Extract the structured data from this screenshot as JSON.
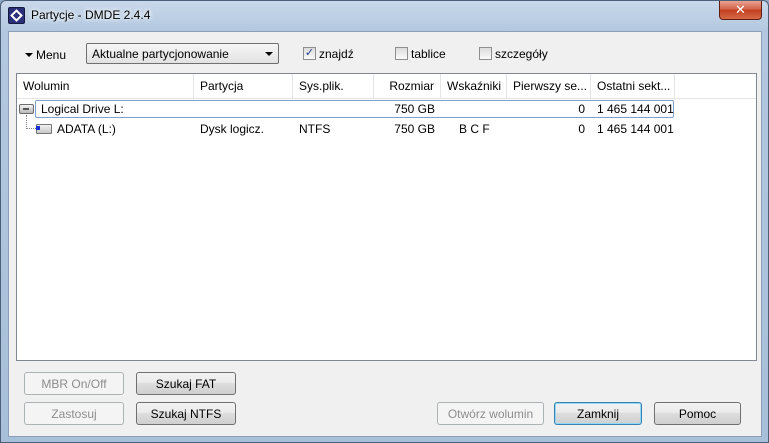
{
  "window": {
    "title": "Partycje - DMDE 2.4.4",
    "close_glyph": "✕"
  },
  "toolbar": {
    "menu_label": "Menu",
    "combo_value": "Aktualne partycjonowanie",
    "checkboxes": [
      {
        "label": "znajdź",
        "checked": true
      },
      {
        "label": "tablice",
        "checked": false
      },
      {
        "label": "szczegóły",
        "checked": false
      }
    ]
  },
  "table": {
    "columns": [
      "Wolumin",
      "Partycja",
      "Sys.plik.",
      "Rozmiar",
      "Wskaźniki",
      "Pierwszy se...",
      "Ostatni sekt..."
    ],
    "rows": [
      {
        "icon": "drive-icon",
        "name": "Logical Drive L:",
        "partition": "",
        "fs": "",
        "size": "750 GB",
        "flags": "",
        "first": "0",
        "last": "1 465 144 001"
      },
      {
        "icon": "partition-icon",
        "name": "ADATA (L:)",
        "partition": "Dysk logicz.",
        "fs": "NTFS",
        "size": "750 GB",
        "flags": "B C F",
        "first": "0",
        "last": "1 465 144 001"
      }
    ]
  },
  "buttons": {
    "mbr": "MBR On/Off",
    "search_fat": "Szukaj FAT",
    "apply": "Zastosuj",
    "search_ntfs": "Szukaj NTFS",
    "open_volume": "Otwórz wolumin",
    "close": "Zamknij",
    "help": "Pomoc"
  }
}
